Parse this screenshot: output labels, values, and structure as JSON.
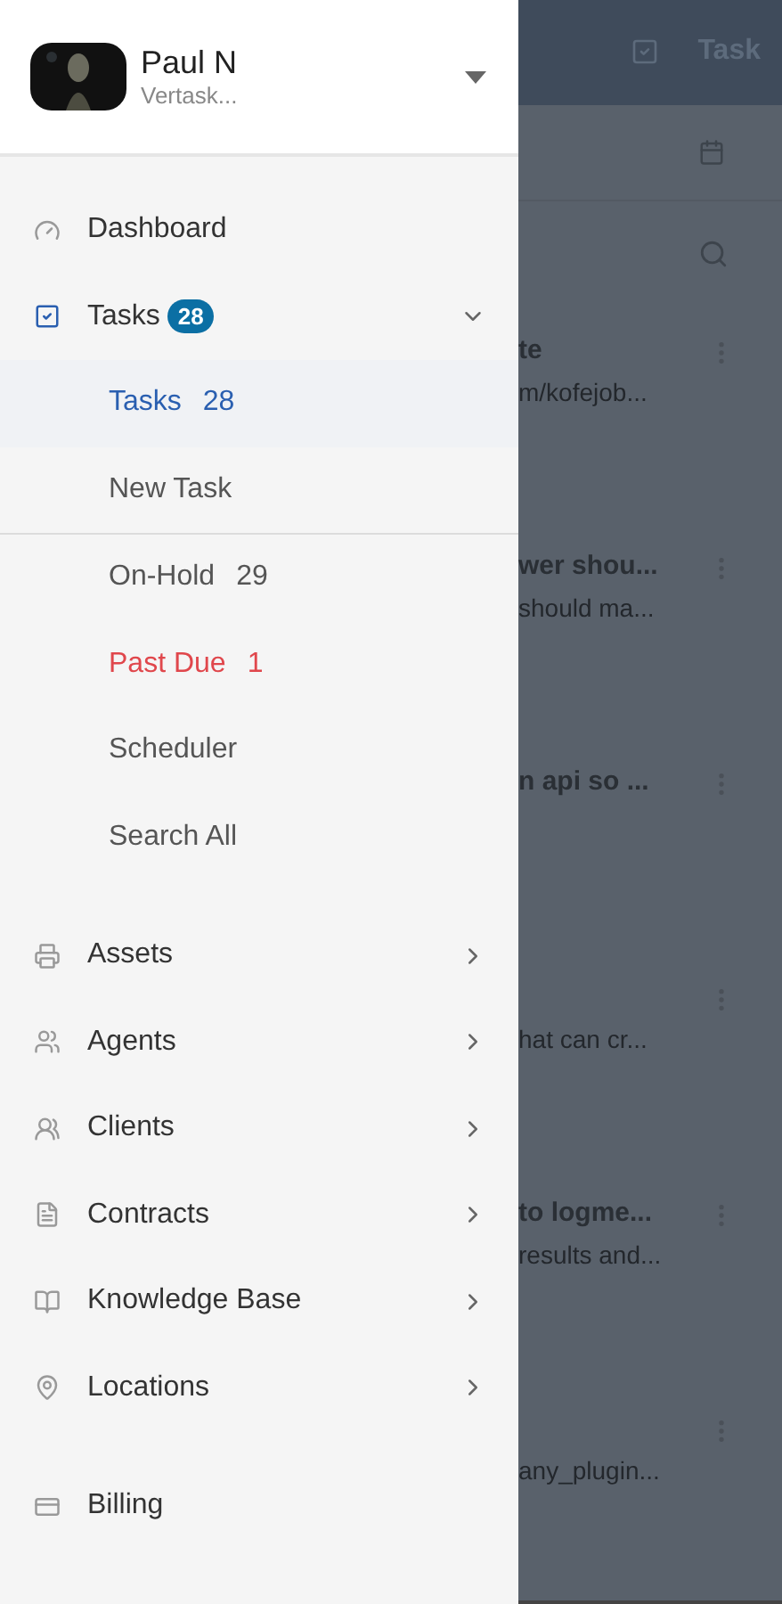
{
  "user": {
    "name": "Paul N",
    "subtitle": "Vertask..."
  },
  "sections": [
    [
      {
        "label": "Dashboard",
        "has_arrow": false
      },
      {
        "label": "Tasks",
        "badge": "28",
        "expanded": true,
        "selected": true,
        "children": [
          {
            "label": "Tasks",
            "count": "28",
            "selected": true,
            "overdue": false,
            "separator": false
          },
          {
            "label": "New Task",
            "selected": false,
            "overdue": false,
            "separator": true
          },
          {
            "label": "On-Hold",
            "count": "29",
            "selected": false,
            "overdue": false,
            "separator": false
          },
          {
            "label": "Past Due",
            "count": "1",
            "selected": false,
            "overdue": true,
            "separator": false
          },
          {
            "label": "Scheduler",
            "selected": false,
            "overdue": false,
            "separator": false
          },
          {
            "label": "Search All",
            "selected": false,
            "overdue": false,
            "separator": false
          }
        ]
      }
    ],
    [
      {
        "label": "Assets",
        "has_arrow": true
      },
      {
        "label": "Agents",
        "has_arrow": true
      },
      {
        "label": "Clients",
        "has_arrow": true
      },
      {
        "label": "Contracts",
        "has_arrow": true
      },
      {
        "label": "Knowledge Base",
        "has_arrow": true
      },
      {
        "label": "Locations",
        "has_arrow": true
      }
    ],
    [
      {
        "label": "Billing",
        "has_arrow": false
      }
    ]
  ],
  "background": {
    "header_text": "Task",
    "items": [
      {
        "title": "te",
        "subtitle": "m/kofejob..."
      },
      {
        "title": "wer shou...",
        "subtitle": "should ma..."
      },
      {
        "title": "n api so ..."
      },
      {
        "subtitle": "hat can cr..."
      },
      {
        "title": "to logme...",
        "subtitle": "results and..."
      },
      {
        "subtitle": "any_plugin..."
      }
    ]
  }
}
